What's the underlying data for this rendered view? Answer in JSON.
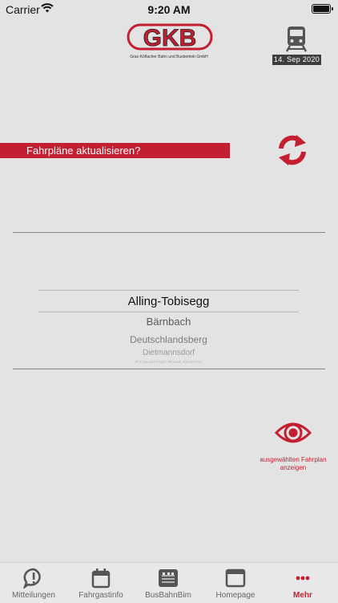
{
  "status_bar": {
    "carrier": "Carrier",
    "time": "9:20 AM"
  },
  "header": {
    "logo_text": "GKB",
    "logo_subtitle": "Graz-Köflacher Bahn und Busbetrieb GmbH",
    "date": "14. Sep 2020"
  },
  "banner": {
    "text": "Fahrpläne aktualisieren?"
  },
  "picker": {
    "items": [
      "Alling-Tobisegg",
      "Bärnbach",
      "Deutschlandsberg",
      "Dietmannsdorf",
      "Frauental-Bad Gams"
    ],
    "selected": "Alling-Tobisegg"
  },
  "view_action": {
    "caption_line1": "ausgewählten Fahrplan",
    "caption_line2": "anzeigen"
  },
  "tabs": [
    {
      "label": "Mitteilungen",
      "icon": "chat-alert-icon"
    },
    {
      "label": "Fahrgastinfo",
      "icon": "calendar-icon"
    },
    {
      "label": "BusBahnBim",
      "icon": "busbahnbim-logo-icon"
    },
    {
      "label": "Homepage",
      "icon": "browser-window-icon"
    },
    {
      "label": "Mehr",
      "icon": "more-dots-icon",
      "active": true
    }
  ],
  "colors": {
    "brand_red": "#c41e31",
    "background": "#e3e3e3"
  }
}
